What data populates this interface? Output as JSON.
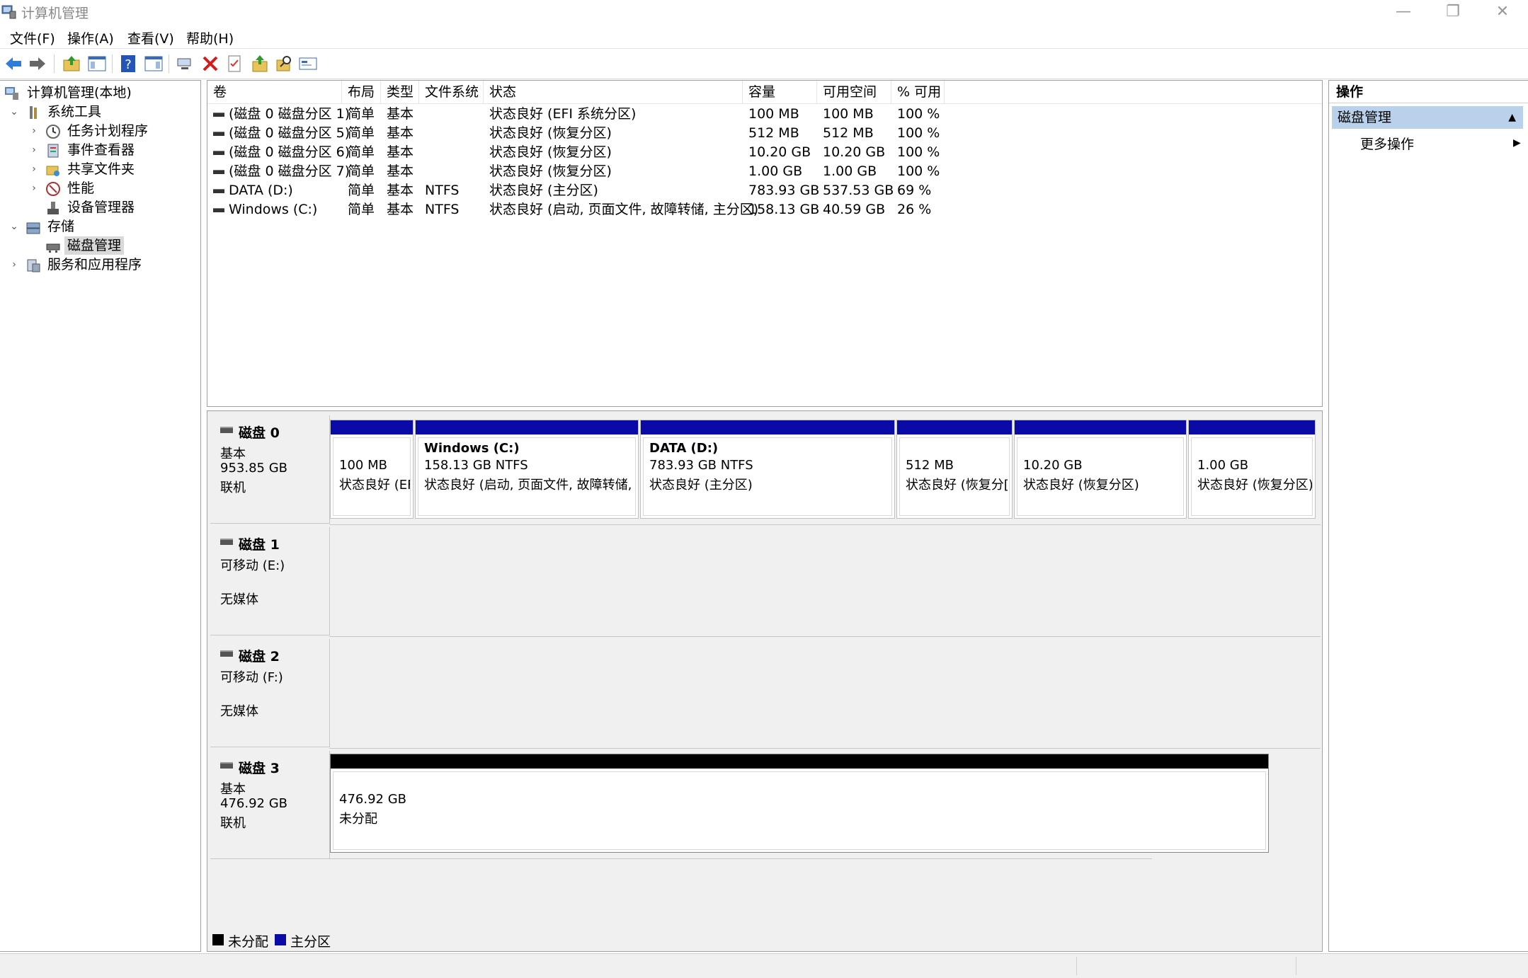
{
  "window": {
    "title": "计算机管理"
  },
  "menu": [
    "文件(F)",
    "操作(A)",
    "查看(V)",
    "帮助(H)"
  ],
  "toolbar": {
    "icons": [
      "back-arrow-icon",
      "forward-arrow-icon",
      "up-folder-icon",
      "show-hide-console-tree-icon",
      "help-icon",
      "show-hide-action-pane-icon",
      "connect-icon",
      "delete-icon",
      "properties-icon",
      "export-icon",
      "search-icon",
      "settings-icon"
    ]
  },
  "tree": {
    "root": "计算机管理(本地)",
    "system_tools": "系统工具",
    "task_scheduler": "任务计划程序",
    "event_viewer": "事件查看器",
    "shared_folders": "共享文件夹",
    "performance": "性能",
    "device_manager": "设备管理器",
    "storage": "存储",
    "disk_management": "磁盘管理",
    "services": "服务和应用程序"
  },
  "volumes": {
    "columns": [
      "卷",
      "布局",
      "类型",
      "文件系统",
      "状态",
      "容量",
      "可用空间",
      "% 可用"
    ],
    "rows": [
      [
        "(磁盘 0 磁盘分区 1)",
        "简单",
        "基本",
        "",
        "状态良好 (EFI 系统分区)",
        "100 MB",
        "100 MB",
        "100 %"
      ],
      [
        "(磁盘 0 磁盘分区 5)",
        "简单",
        "基本",
        "",
        "状态良好 (恢复分区)",
        "512 MB",
        "512 MB",
        "100 %"
      ],
      [
        "(磁盘 0 磁盘分区 6)",
        "简单",
        "基本",
        "",
        "状态良好 (恢复分区)",
        "10.20 GB",
        "10.20 GB",
        "100 %"
      ],
      [
        "(磁盘 0 磁盘分区 7)",
        "简单",
        "基本",
        "",
        "状态良好 (恢复分区)",
        "1.00 GB",
        "1.00 GB",
        "100 %"
      ],
      [
        "DATA (D:)",
        "简单",
        "基本",
        "NTFS",
        "状态良好 (主分区)",
        "783.93 GB",
        "537.53 GB",
        "69 %"
      ],
      [
        "Windows (C:)",
        "简单",
        "基本",
        "NTFS",
        "状态良好 (启动, 页面文件, 故障转储, 主分区)",
        "158.13 GB",
        "40.59 GB",
        "26 %"
      ]
    ]
  },
  "disks": [
    {
      "name": "磁盘 0",
      "line1": "基本",
      "line2": "953.85 GB",
      "line3": "联机",
      "partitions": [
        {
          "title": "",
          "size": "100 MB",
          "status": "状态良好 (EF"
        },
        {
          "title": "Windows  (C:)",
          "size": "158.13 GB NTFS",
          "status": "状态良好 (启动, 页面文件, 故障转储, 主"
        },
        {
          "title": "DATA  (D:)",
          "size": "783.93 GB NTFS",
          "status": "状态良好 (主分区)"
        },
        {
          "title": "",
          "size": "512 MB",
          "status": "状态良好 (恢复分["
        },
        {
          "title": "",
          "size": "10.20 GB",
          "status": "状态良好 (恢复分区)"
        },
        {
          "title": "",
          "size": "1.00 GB",
          "status": "状态良好 (恢复分区)"
        }
      ]
    },
    {
      "name": "磁盘 1",
      "line1": "可移动 (E:)",
      "line2": "",
      "line3": "无媒体"
    },
    {
      "name": "磁盘 2",
      "line1": "可移动 (F:)",
      "line2": "",
      "line3": "无媒体"
    },
    {
      "name": "磁盘 3",
      "line1": "基本",
      "line2": "476.92 GB",
      "line3": "联机",
      "partitions": [
        {
          "title": "",
          "size": "476.92 GB",
          "status": "未分配"
        }
      ]
    }
  ],
  "legend": {
    "unallocated": "未分配",
    "primary": "主分区"
  },
  "colors": {
    "primary": "#0a0aa6",
    "unallocated": "#000000",
    "selected_action": "#b9d1ea"
  },
  "actions": {
    "header": "操作",
    "section": "磁盘管理",
    "more": "更多操作"
  }
}
